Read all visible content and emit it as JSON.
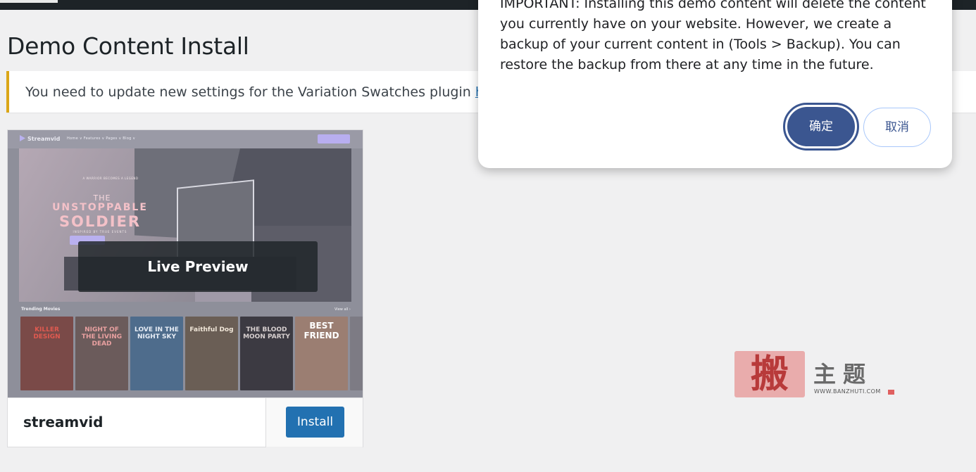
{
  "page": {
    "title": "Demo Content Install"
  },
  "notice": {
    "text": "You need to update new settings for the Variation Swatches plugin ",
    "link_text": "here",
    "suffix": "."
  },
  "theme": {
    "name": "streamvid",
    "live_preview_label": "Live Preview",
    "install_label": "Install",
    "screenshot": {
      "logo": "Streamvid",
      "nav": "Home ∨   Features ∨   Pages ∨   Blog ∨",
      "hero_sub": "A WARRIOR BECOMES A LEGEND",
      "hero_kicker": "THE",
      "hero_title_1": "UNSTOPPABLE",
      "hero_title_2": "SOLDIER",
      "hero_tagline": "INSPIRED BY TRUE EVENTS",
      "trending": "Trending Movies",
      "view_all": "View all ›",
      "posters": [
        {
          "title": "KILLER DESIGN",
          "color": "#7a4a48",
          "text_color": "#e05a50"
        },
        {
          "title": "NIGHT OF THE LIVING DEAD",
          "color": "#6b5b5b",
          "text_color": "#e8a0a0"
        },
        {
          "title": "LOVE IN THE NIGHT SKY",
          "color": "#4e6c8c",
          "text_color": "#e6ecf5"
        },
        {
          "title": "Faithful Dog",
          "color": "#6a5e55",
          "text_color": "#f0e6d8"
        },
        {
          "title": "THE BLOOD MOON PARTY",
          "color": "#3c3a42",
          "text_color": "#d8d0d0"
        },
        {
          "title": "BEST FRIEND",
          "color": "#9b7e72",
          "text_color": "#ffffff"
        }
      ]
    }
  },
  "dialog": {
    "message": "IMPORTANT: Installing this demo content will delete the content you currently have on your website. However, we create a backup of your current content in (Tools > Backup). You can restore the backup from there at any time in the future.",
    "ok_label": "确定",
    "cancel_label": "取消"
  },
  "watermark": {
    "seal_char": "搬",
    "text": "主题",
    "url": "WWW.BANZHUTI.COM"
  }
}
